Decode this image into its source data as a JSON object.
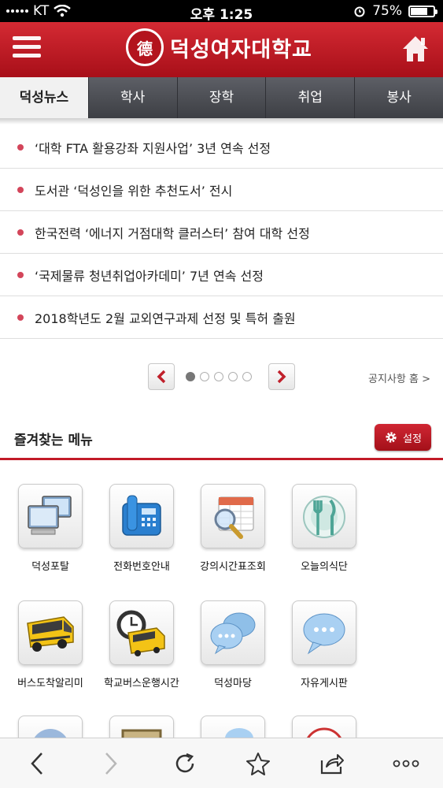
{
  "status_bar": {
    "carrier": "KT",
    "time": "오후 1:25",
    "battery": "75%",
    "battery_level": 0.75
  },
  "header": {
    "seal_text": "德",
    "title": "덕성여자대학교"
  },
  "tabs": [
    {
      "label": "덕성뉴스",
      "active": true
    },
    {
      "label": "학사",
      "active": false
    },
    {
      "label": "장학",
      "active": false
    },
    {
      "label": "취업",
      "active": false
    },
    {
      "label": "봉사",
      "active": false
    }
  ],
  "news": [
    {
      "title": "‘대학 FTA 활용강좌 지원사업’ 3년 연속 선정"
    },
    {
      "title": "도서관 ‘덕성인을 위한 추천도서’ 전시"
    },
    {
      "title": "한국전력 ‘에너지 거점대학 클러스터’ 참여 대학 선정"
    },
    {
      "title": "‘국제물류 청년취업아카데미’ 7년 연속 선정"
    },
    {
      "title": "2018학년도 2월 교외연구과제 선정 및 특허 출원"
    }
  ],
  "pager": {
    "current_page": 1,
    "page_count": 5,
    "notice_home_label": "공지사항 홈 >"
  },
  "favorites": {
    "title": "즐겨찾는 메뉴",
    "settings_label": "설정",
    "items": [
      {
        "label": "덕성포탈",
        "icon": "computer-icon"
      },
      {
        "label": "전화번호안내",
        "icon": "telephone-icon"
      },
      {
        "label": "강의시간표조회",
        "icon": "calendar-search-icon"
      },
      {
        "label": "오늘의식단",
        "icon": "plate-utensils-icon"
      },
      {
        "label": "버스도착알리미",
        "icon": "school-bus-icon"
      },
      {
        "label": "학교버스운행시간",
        "icon": "bus-clock-icon"
      },
      {
        "label": "덕성마당",
        "icon": "speech-bubbles-icon"
      },
      {
        "label": "자유게시판",
        "icon": "speech-bubble-icon"
      }
    ]
  },
  "colors": {
    "brand_red": "#c21b27",
    "news_dot": "#d3455a",
    "tab_dark": "#4a4c52"
  }
}
